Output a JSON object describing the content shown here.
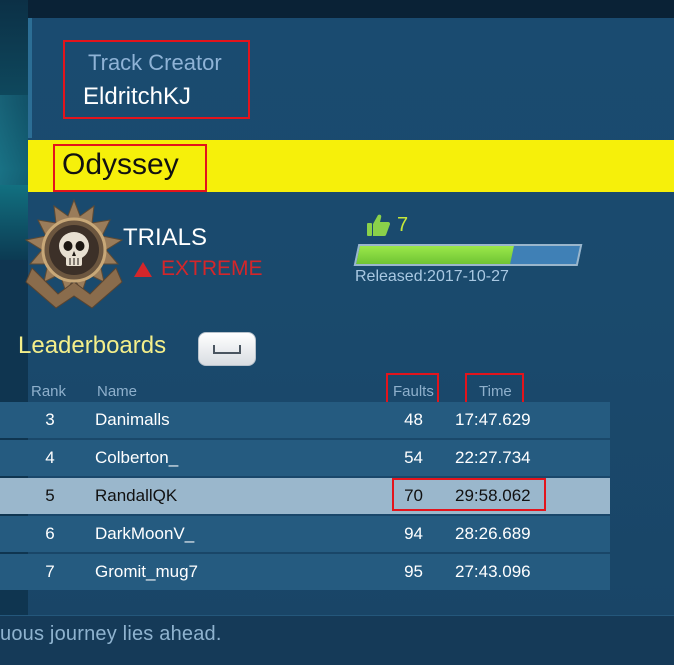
{
  "track": {
    "creator_label": "Track Creator",
    "creator_name": "EldritchKJ",
    "title": "Odyssey"
  },
  "event": {
    "mode": "TRIALS",
    "difficulty": "EXTREME"
  },
  "stats": {
    "likes": "7",
    "rating_fraction": 0.7,
    "released": "Released:2017-10-27"
  },
  "leaderboard": {
    "title": "Leaderboards",
    "columns": {
      "rank": "Rank",
      "name": "Name",
      "faults": "Faults",
      "time": "Time"
    },
    "rows": [
      {
        "rank": "3",
        "name": "Danimalls",
        "faults": "48",
        "time": "17:47.629"
      },
      {
        "rank": "4",
        "name": "Colberton_",
        "faults": "54",
        "time": "22:27.734"
      },
      {
        "rank": "5",
        "name": "RandallQK",
        "faults": "70",
        "time": "29:58.062"
      },
      {
        "rank": "6",
        "name": "DarkMoonV_",
        "faults": "94",
        "time": "28:26.689"
      },
      {
        "rank": "7",
        "name": "Gromit_mug7",
        "faults": "95",
        "time": "27:43.096"
      }
    ]
  },
  "footer": {
    "text": "uous journey lies ahead."
  },
  "colors": {
    "title_bar": "#f6f00a",
    "panel": "#1a4b70",
    "difficulty": "#d4262a",
    "likes": "#c6e83a",
    "highlight_row": "#9ab7cc",
    "annotation": "#e3141c"
  },
  "icons": {
    "emblem": "skull-emblem-icon",
    "thumb": "thumbs-up-icon",
    "difficulty": "warning-triangle-icon"
  }
}
